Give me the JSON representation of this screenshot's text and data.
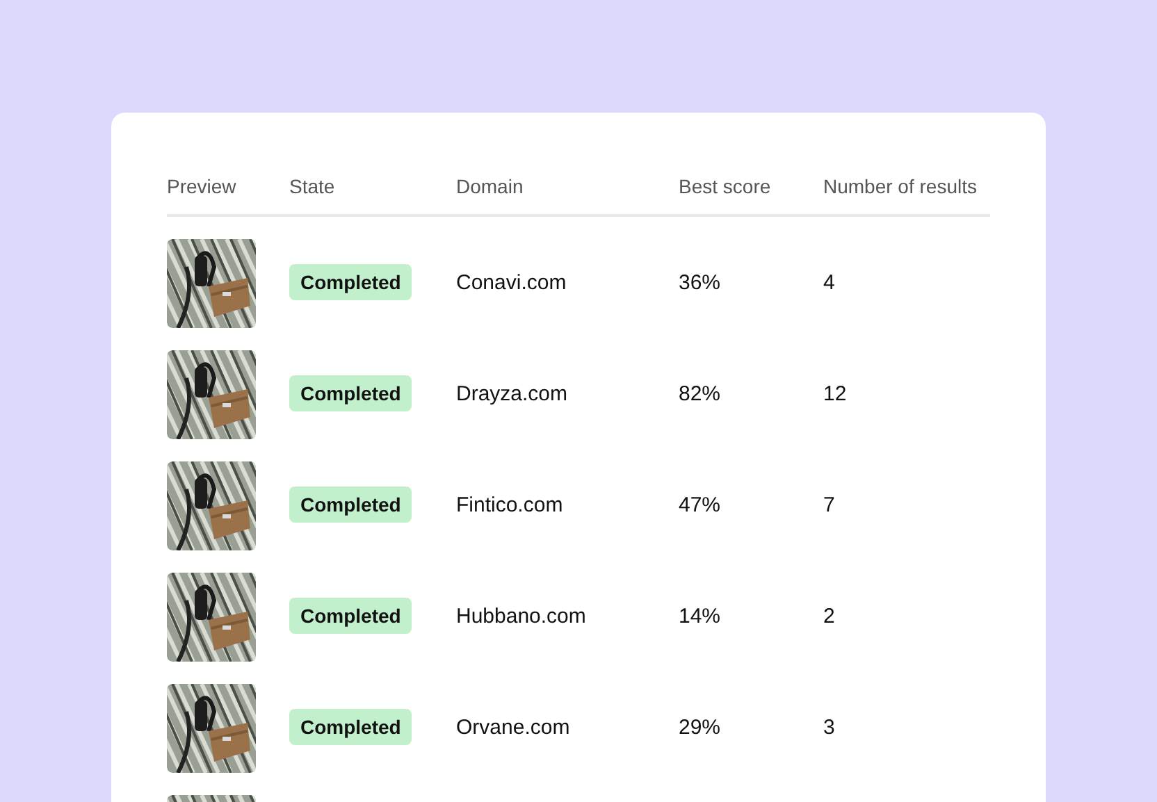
{
  "table": {
    "columns": [
      "Preview",
      "State",
      "Domain",
      "Best score",
      "Number of results"
    ],
    "rows": [
      {
        "preview": {
          "kind": "picture"
        },
        "state": "Completed",
        "domain": "Conavi.com",
        "best_score": "36%",
        "results": "4"
      },
      {
        "preview": {
          "kind": "picture"
        },
        "state": "Completed",
        "domain": "Drayza.com",
        "best_score": "82%",
        "results": "12"
      },
      {
        "preview": {
          "kind": "picture"
        },
        "state": "Completed",
        "domain": "Fintico.com",
        "best_score": "47%",
        "results": "7"
      },
      {
        "preview": {
          "kind": "picture"
        },
        "state": "Completed",
        "domain": "Hubbano.com",
        "best_score": "14%",
        "results": "2"
      },
      {
        "preview": {
          "kind": "picture"
        },
        "state": "Completed",
        "domain": "Orvane.com",
        "best_score": "29%",
        "results": "3"
      },
      {
        "preview": {
          "kind": "picture"
        }
      }
    ]
  }
}
